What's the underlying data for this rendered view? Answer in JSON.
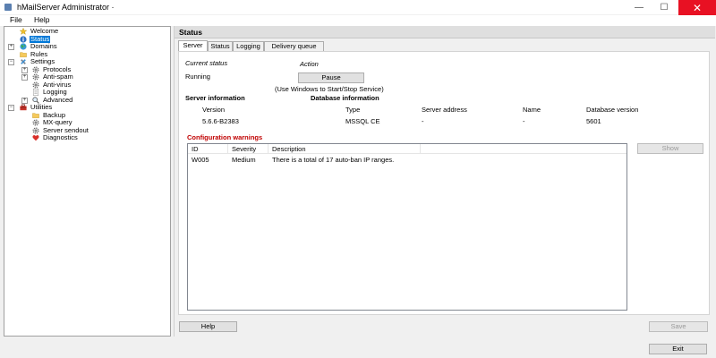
{
  "window": {
    "title": "hMailServer Administrator ·",
    "close_glyph": "✕",
    "min_glyph": "—",
    "max_glyph": "☐"
  },
  "menu": [
    {
      "label": "File"
    },
    {
      "label": "Help"
    }
  ],
  "tree": {
    "items": [
      {
        "label": "Welcome",
        "icon": "star-icon"
      },
      {
        "label": "Status",
        "icon": "info-icon",
        "selected": true
      },
      {
        "label": "Domains",
        "icon": "globe-icon"
      },
      {
        "label": "Rules",
        "icon": "folder-icon"
      },
      {
        "label": "Settings",
        "icon": "tools-icon"
      },
      {
        "label": "Protocols",
        "icon": "gear-icon"
      },
      {
        "label": "Anti-spam",
        "icon": "gear-icon"
      },
      {
        "label": "Anti-virus",
        "icon": "gear-icon"
      },
      {
        "label": "Logging",
        "icon": "document-icon"
      },
      {
        "label": "Advanced",
        "icon": "magnifier-icon"
      },
      {
        "label": "Utilities",
        "icon": "toolbox-icon"
      },
      {
        "label": "Backup",
        "icon": "folder-icon"
      },
      {
        "label": "MX-query",
        "icon": "gear-icon"
      },
      {
        "label": "Server sendout",
        "icon": "gear-icon"
      },
      {
        "label": "Diagnostics",
        "icon": "heart-icon"
      }
    ]
  },
  "panel": {
    "title": "Status"
  },
  "tabs": [
    {
      "label": "Server",
      "active": true
    },
    {
      "label": "Status"
    },
    {
      "label": "Logging"
    },
    {
      "label": "Delivery queue"
    }
  ],
  "server": {
    "current_status_label": "Current status",
    "action_label": "Action",
    "status_value": "Running",
    "pause_button": "Pause",
    "hint": "(Use Windows to Start/Stop Service)",
    "server_info_heading": "Server information",
    "database_info_heading": "Database information",
    "version_label": "Version",
    "version_value": "5.6.6-B2383",
    "type_label": "Type",
    "type_value": "MSSQL CE",
    "server_address_label": "Server address",
    "server_address_value": "-",
    "name_label": "Name",
    "name_value": "-",
    "db_version_label": "Database version",
    "db_version_value": "5601"
  },
  "warnings": {
    "heading": "Configuration warnings",
    "columns": [
      "ID",
      "Severity",
      "Description"
    ],
    "rows": [
      {
        "id": "W005",
        "severity": "Medium",
        "description": "There is a total of 17 auto-ban IP ranges."
      }
    ],
    "show_button": "Show"
  },
  "footer": {
    "help_button": "Help",
    "save_button": "Save",
    "exit_button": "Exit"
  },
  "colors": {
    "selection": "#0078d7",
    "warning_heading": "#c00000",
    "close_button": "#e81123"
  }
}
